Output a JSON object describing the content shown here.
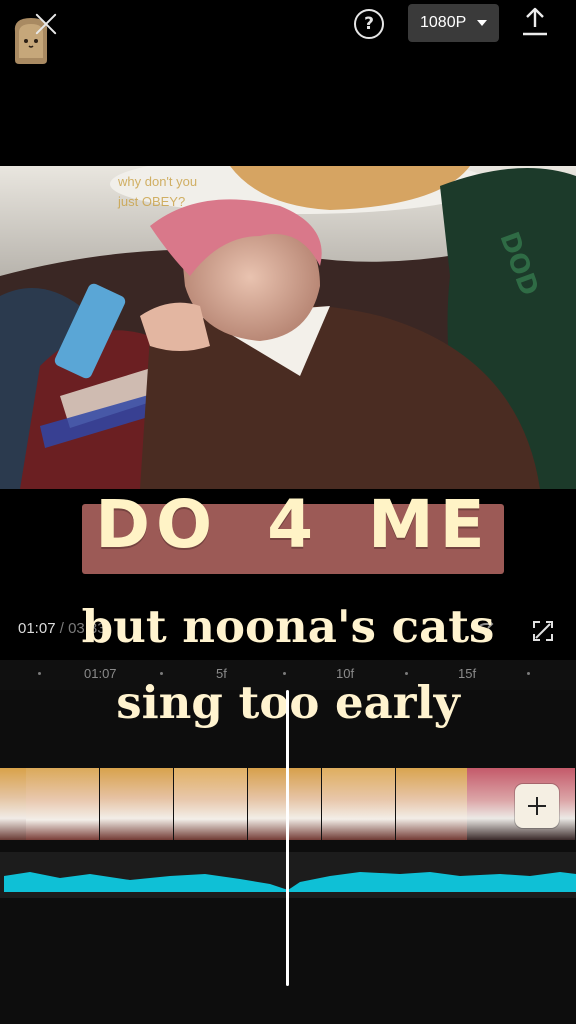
{
  "topbar": {
    "resolution_label": "1080P",
    "help_label": "?"
  },
  "preview": {
    "lyric_overlay_line1": "why don't you",
    "lyric_overlay_line2": "just OBEY?",
    "title_text": "DO 4 ME",
    "subtitle_line1": "but noona's cats",
    "subtitle_line2": "sing too early"
  },
  "timeline": {
    "current_time": "01:07",
    "separator": " / ",
    "total_time": "03:33",
    "ruler_labels": [
      "01:07",
      "5f",
      "10f",
      "15f"
    ]
  },
  "colors": {
    "title_bg": "#9c5a56",
    "title_text": "#fff3c6",
    "audio_wave": "#0fc0d6"
  }
}
